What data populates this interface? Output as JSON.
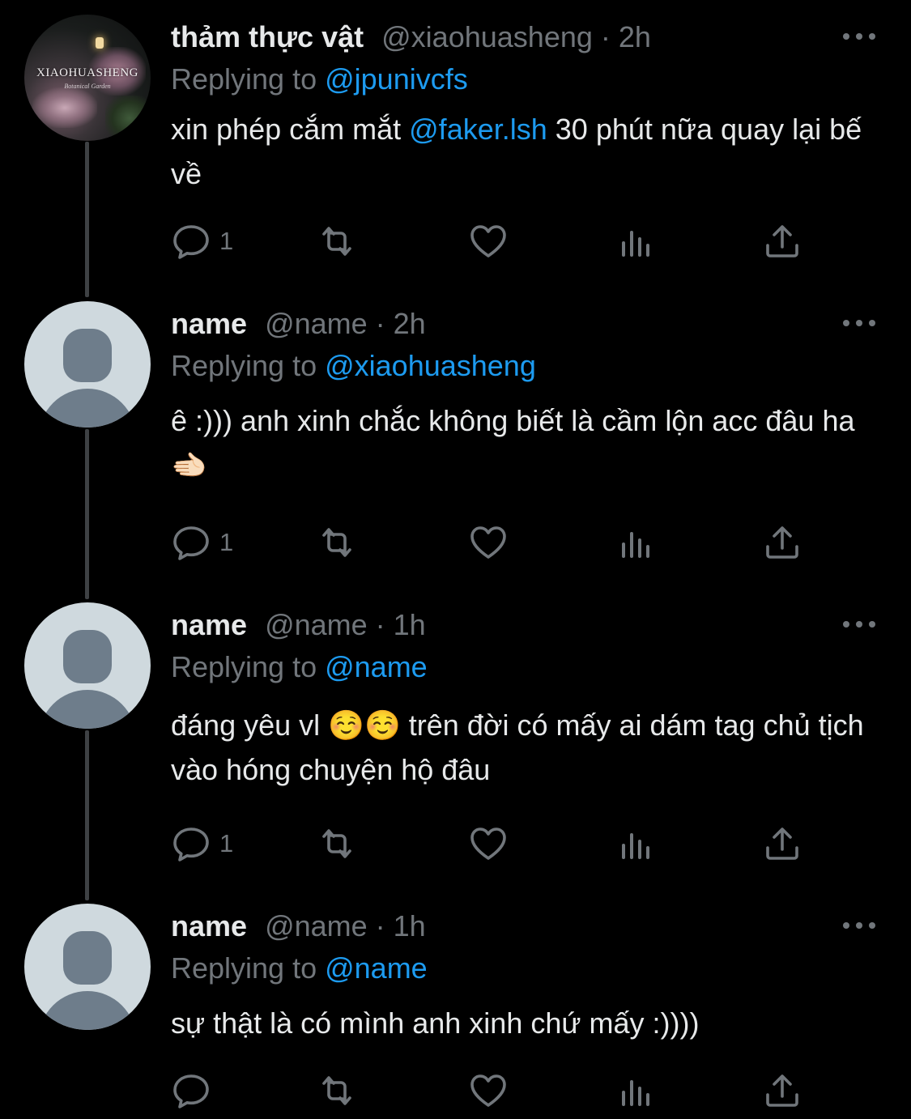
{
  "colors": {
    "background": "#000000",
    "text": "#e7e9ea",
    "muted": "#71767b",
    "link": "#1d9bf0",
    "thread_line": "#3e4144"
  },
  "icons": {
    "reply": "speech-bubble-icon",
    "retweet": "retweet-arrows-icon",
    "like": "heart-icon",
    "views": "bar-chart-icon",
    "share": "share-upload-icon",
    "more": "three-dots-icon"
  },
  "tweets": [
    {
      "display_name": "thảm thực vật",
      "meta": "@xiaohuasheng · 2h",
      "replying_label": "Replying to ",
      "replying_to": "@jpunivcfs",
      "avatar_logo": "XIAOHUASHENG",
      "avatar_logo_sub": "Botanical Garden",
      "text_before": "xin phép cắm mắt ",
      "text_mention": "@faker.lsh",
      "text_after": " 30 phút nữa quay lại bế về",
      "reply_count": "1"
    },
    {
      "display_name": "name",
      "meta": "@name · 2h",
      "replying_label": "Replying to ",
      "replying_to": "@xiaohuasheng",
      "text_before": "ê :))) anh xinh chắc không biết là cầm lộn acc đâu ha 🫲🏻",
      "text_mention": "",
      "text_after": "",
      "reply_count": "1"
    },
    {
      "display_name": "name",
      "meta": "@name · 1h",
      "replying_label": "Replying to ",
      "replying_to": "@name",
      "text_before": "đáng yêu vl ☺️☺️  trên đời có mấy ai dám tag chủ tịch vào hóng chuyện hộ đâu",
      "text_mention": "",
      "text_after": "",
      "reply_count": "1"
    },
    {
      "display_name": "name",
      "meta": "@name · 1h",
      "replying_label": "Replying to ",
      "replying_to": "@name",
      "text_before": "sự thật là có mình anh xinh chứ mấy :))))",
      "text_mention": "",
      "text_after": "",
      "reply_count": ""
    }
  ]
}
